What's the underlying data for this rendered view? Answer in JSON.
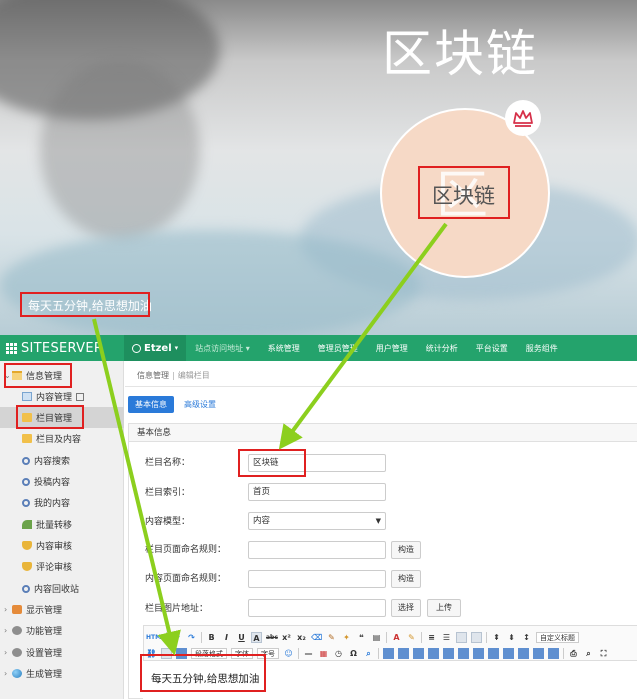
{
  "banner": {
    "title": "区块链",
    "avatar_text": "区块链",
    "avatar_ghost": "区",
    "slogan": "每天五分钟,给思想加油"
  },
  "colors": {
    "nav_green": "#24a36c",
    "primary_blue": "#2a7ad9",
    "annotation_red": "#e02020",
    "arrow_green": "#8ccf1e"
  },
  "topnav": {
    "logo": "SITESERVER",
    "site": "Etzel",
    "items": [
      "站点访问地址",
      "系统管理",
      "管理员管理",
      "用户管理",
      "统计分析",
      "平台设置",
      "服务组件"
    ]
  },
  "sidebar": {
    "root": "信息管理",
    "items": [
      "内容管理",
      "栏目管理",
      "栏目及内容",
      "内容搜索",
      "投稿内容",
      "我的内容",
      "批量转移",
      "内容审核",
      "评论审核",
      "内容回收站"
    ],
    "groups": [
      "显示管理",
      "功能管理",
      "设置管理",
      "生成管理"
    ]
  },
  "main": {
    "breadcrumb": [
      "信息管理",
      "编辑栏目"
    ],
    "tabs": [
      "基本信息",
      "高级设置"
    ],
    "panel_title": "基本信息",
    "fields": {
      "name_label": "栏目名称：",
      "name_value": "区块链",
      "index_label": "栏目索引：",
      "index_value": "首页",
      "model_label": "内容模型：",
      "model_value": "内容",
      "page_rule_label": "栏目页面命名规则：",
      "content_rule_label": "内容页面命名规则：",
      "image_label": "栏目图片地址："
    },
    "buttons": {
      "construct_1": "构造",
      "construct_2": "构造",
      "choose": "选择",
      "upload": "上传"
    },
    "toolbar": {
      "html_label": "HTML",
      "paragraph": "段落格式",
      "custom_title": "自定义标题",
      "font_family": "字体",
      "font_size": "字号"
    },
    "editor_text": "每天五分钟,给思想加油"
  }
}
